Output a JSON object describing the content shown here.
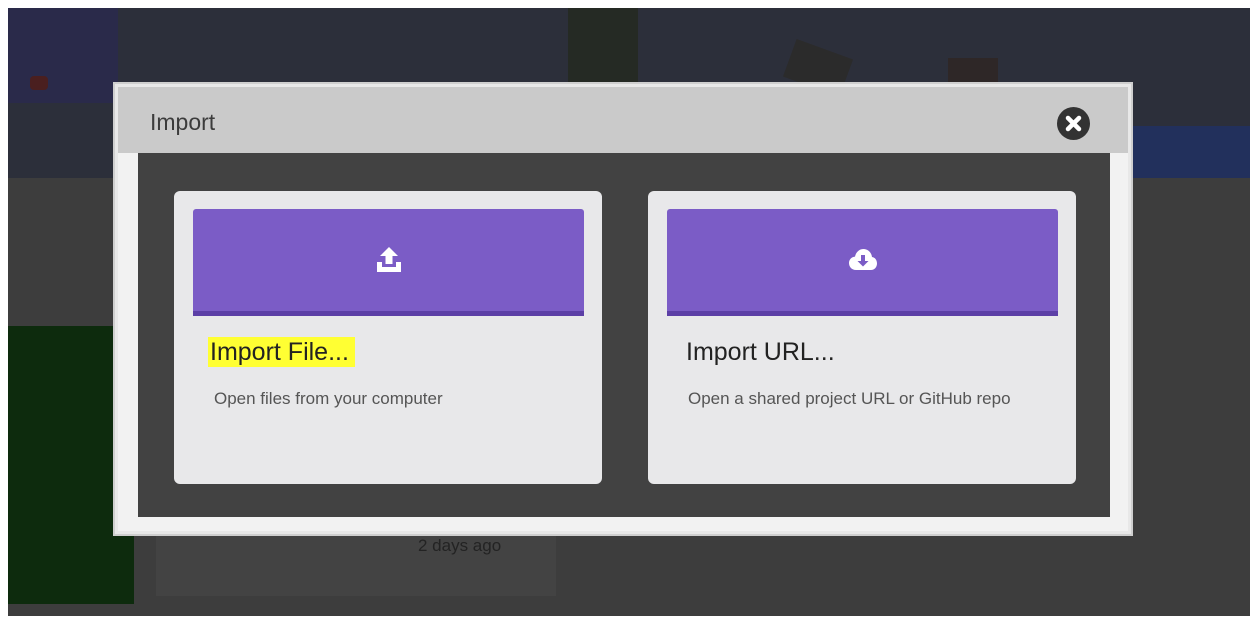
{
  "background": {
    "timestamp": "2 days ago"
  },
  "dialog": {
    "title": "Import",
    "close_icon": "close-circle-icon",
    "options": [
      {
        "title": "Import File...",
        "description": "Open files from your computer",
        "icon": "upload-icon",
        "highlighted": true
      },
      {
        "title": "Import URL...",
        "description": "Open a shared project URL or GitHub repo",
        "icon": "cloud-download-icon",
        "highlighted": false
      }
    ]
  },
  "colors": {
    "accent": "#7b5cc6",
    "accent_dark": "#5c3fa6",
    "highlight": "#ffff33",
    "backdrop": "#3d3d3d"
  }
}
